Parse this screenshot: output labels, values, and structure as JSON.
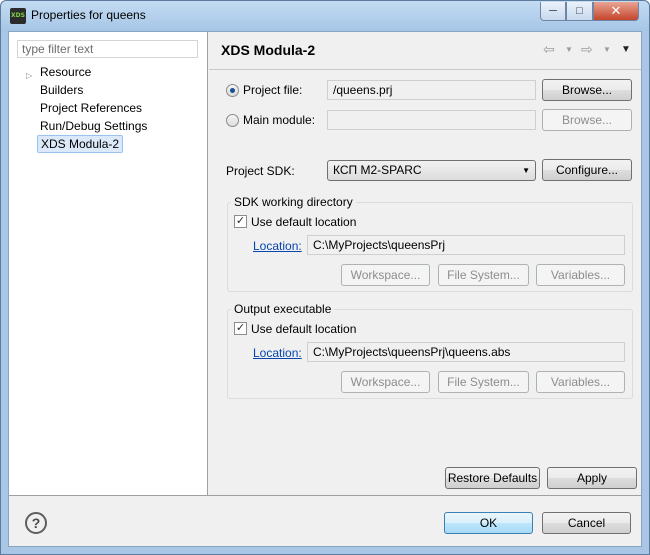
{
  "window": {
    "title": "Properties for queens",
    "app_icon_text": "XDS"
  },
  "sidebar": {
    "filter_placeholder": "type filter text",
    "items": [
      {
        "label": "Resource",
        "expandable": true
      },
      {
        "label": "Builders"
      },
      {
        "label": "Project References"
      },
      {
        "label": "Run/Debug Settings"
      },
      {
        "label": "XDS Modula-2",
        "selected": true
      }
    ]
  },
  "page": {
    "title": "XDS Modula-2",
    "project_file": {
      "label": "Project file:",
      "value": "/queens.prj",
      "selected": true,
      "browse": "Browse..."
    },
    "main_module": {
      "label": "Main module:",
      "value": "",
      "selected": false,
      "browse": "Browse..."
    },
    "sdk": {
      "label": "Project SDK:",
      "value": "КСП M2-SPARC",
      "configure": "Configure..."
    },
    "sdk_working_dir": {
      "title": "SDK working directory",
      "use_default_label": "Use default location",
      "use_default_checked": true,
      "location_label": "Location:",
      "location_value": "C:\\MyProjects\\queensPrj",
      "buttons": {
        "workspace": "Workspace...",
        "filesystem": "File System...",
        "variables": "Variables..."
      }
    },
    "output_exec": {
      "title": "Output executable",
      "use_default_label": "Use default location",
      "use_default_checked": true,
      "location_label": "Location:",
      "location_value": "C:\\MyProjects\\queensPrj\\queens.abs",
      "buttons": {
        "workspace": "Workspace...",
        "filesystem": "File System...",
        "variables": "Variables..."
      }
    },
    "restore_defaults": "Restore Defaults",
    "apply": "Apply"
  },
  "footer": {
    "help": "?",
    "ok": "OK",
    "cancel": "Cancel"
  }
}
